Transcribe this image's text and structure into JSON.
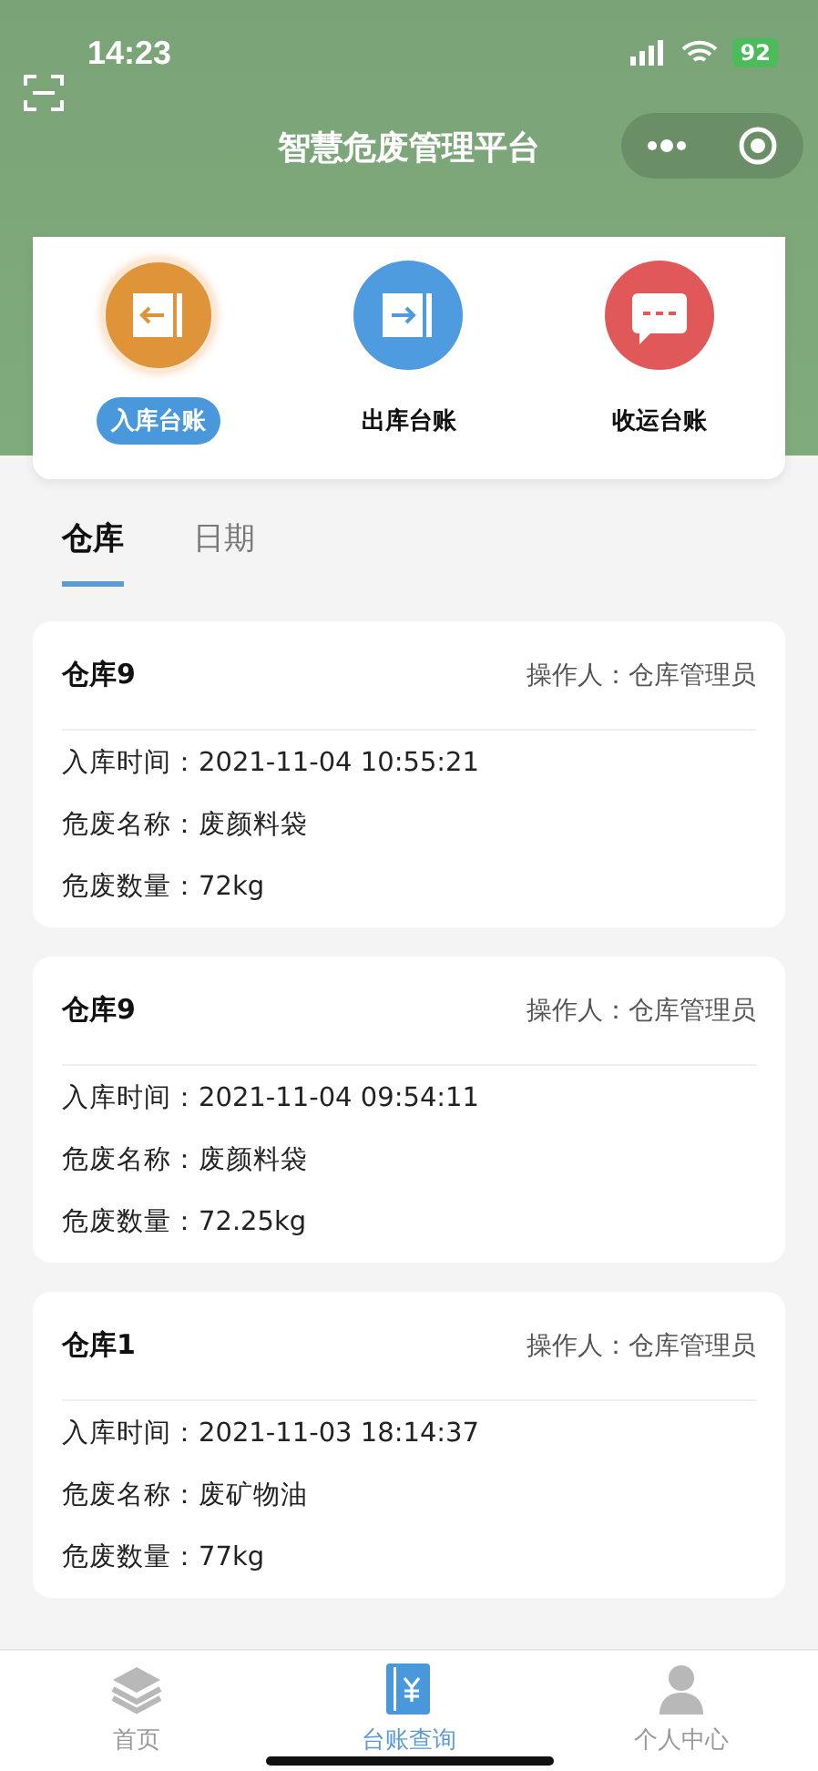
{
  "status_bar": {
    "time": "14:23",
    "battery": "92"
  },
  "header": {
    "title": "智慧危废管理平台"
  },
  "categories": [
    {
      "label": "入库台账",
      "kind": "in",
      "selected": true
    },
    {
      "label": "出库台账",
      "kind": "out",
      "selected": false
    },
    {
      "label": "收运台账",
      "kind": "transport",
      "selected": false
    }
  ],
  "tabs": [
    {
      "label": "仓库",
      "selected": true
    },
    {
      "label": "日期",
      "selected": false
    }
  ],
  "records": [
    {
      "warehouse": "仓库9",
      "operator": "操作人：仓库管理员",
      "fields": [
        "入库时间：2021-11-04 10:55:21",
        "危废名称：废颜料袋",
        "危废数量：72kg"
      ]
    },
    {
      "warehouse": "仓库9",
      "operator": "操作人：仓库管理员",
      "fields": [
        "入库时间：2021-11-04 09:54:11",
        "危废名称：废颜料袋",
        "危废数量：72.25kg"
      ]
    },
    {
      "warehouse": "仓库1",
      "operator": "操作人：仓库管理员",
      "fields": [
        "入库时间：2021-11-03 18:14:37",
        "危废名称：废矿物油",
        "危废数量：77kg"
      ]
    }
  ],
  "bottom_nav": [
    {
      "label": "首页",
      "kind": "home",
      "selected": false
    },
    {
      "label": "台账查询",
      "kind": "ledger",
      "selected": true
    },
    {
      "label": "个人中心",
      "kind": "profile",
      "selected": false
    }
  ]
}
